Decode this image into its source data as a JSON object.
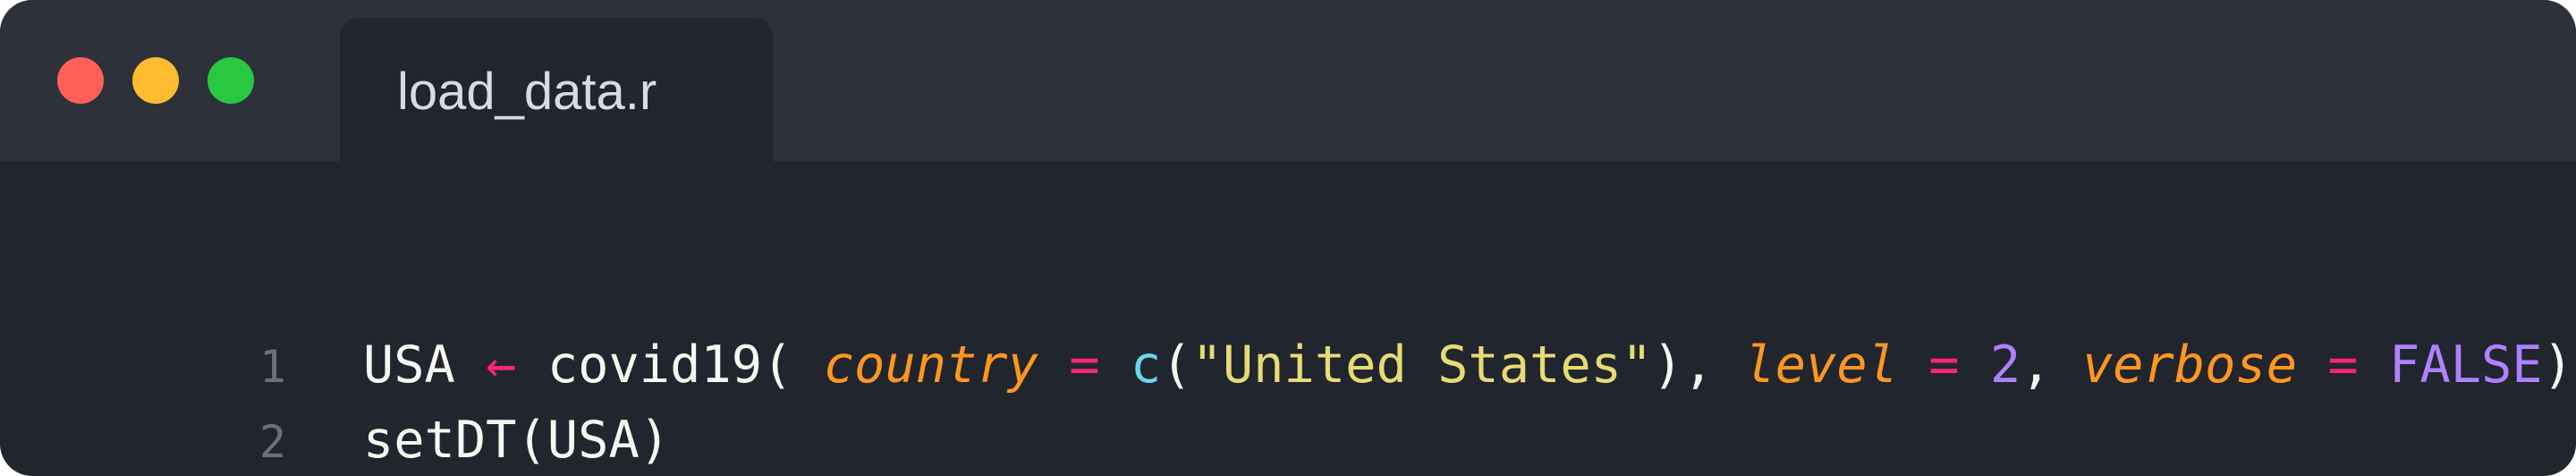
{
  "window": {
    "traffic_lights": [
      {
        "name": "close",
        "color": "#ff5f57"
      },
      {
        "name": "minimize",
        "color": "#febc2e"
      },
      {
        "name": "zoom",
        "color": "#28c840"
      }
    ]
  },
  "tab": {
    "filename": "load_data.r"
  },
  "editor": {
    "colors": {
      "background": "#21252d",
      "titlebar": "#2d313a",
      "line_number": "#6a707c",
      "default": "#f8f8f2",
      "operator": "#f92672",
      "parameter": "#fd971f",
      "builtin": "#66d9ef",
      "string": "#e6db74",
      "constant": "#ae81ff"
    },
    "lines": [
      {
        "number": "1",
        "tokens": [
          {
            "text": "USA ",
            "kind": "default"
          },
          {
            "text": "←",
            "kind": "operator"
          },
          {
            "text": " covid19( ",
            "kind": "default"
          },
          {
            "text": "country",
            "kind": "parameter"
          },
          {
            "text": " ",
            "kind": "default"
          },
          {
            "text": "=",
            "kind": "operator"
          },
          {
            "text": " ",
            "kind": "default"
          },
          {
            "text": "c",
            "kind": "builtin"
          },
          {
            "text": "(",
            "kind": "default"
          },
          {
            "text": "\"United States\"",
            "kind": "string"
          },
          {
            "text": "), ",
            "kind": "default"
          },
          {
            "text": "level",
            "kind": "parameter"
          },
          {
            "text": " ",
            "kind": "default"
          },
          {
            "text": "=",
            "kind": "operator"
          },
          {
            "text": " ",
            "kind": "default"
          },
          {
            "text": "2",
            "kind": "constant"
          },
          {
            "text": ", ",
            "kind": "default"
          },
          {
            "text": "verbose",
            "kind": "parameter"
          },
          {
            "text": " ",
            "kind": "default"
          },
          {
            "text": "=",
            "kind": "operator"
          },
          {
            "text": " ",
            "kind": "default"
          },
          {
            "text": "FALSE",
            "kind": "constant"
          },
          {
            "text": ")",
            "kind": "default"
          }
        ]
      },
      {
        "number": "2",
        "tokens": [
          {
            "text": "setDT(USA)",
            "kind": "default"
          }
        ]
      }
    ]
  }
}
